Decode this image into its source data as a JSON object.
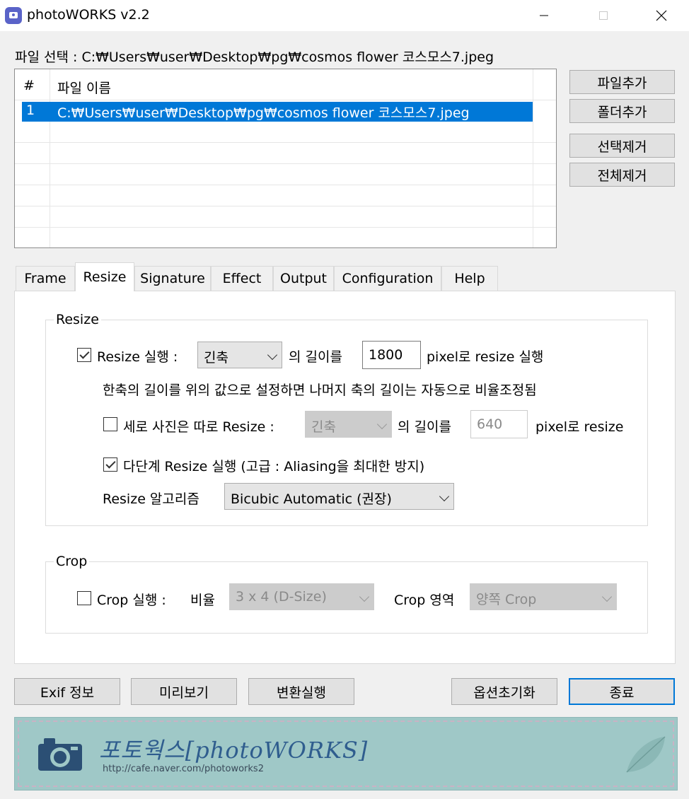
{
  "window": {
    "title": "photoWORKS v2.2",
    "minimize_glyph": "—",
    "maximize_glyph": "☐",
    "close_glyph": "✕"
  },
  "file_select": {
    "label": "파일 선택 : C:₩Users₩user₩Desktop₩pg₩cosmos flower 코스모스7.jpeg"
  },
  "file_list": {
    "columns": [
      "#",
      "파일 이름"
    ],
    "rows": [
      {
        "num": "1",
        "name": "C:₩Users₩user₩Desktop₩pg₩cosmos flower 코스모스7.jpeg",
        "selected": true
      }
    ]
  },
  "side_buttons": {
    "add_file": "파일추가",
    "add_folder": "폴더추가",
    "remove_selected": "선택제거",
    "remove_all": "전체제거"
  },
  "tabs": [
    {
      "label": "Frame",
      "active": false
    },
    {
      "label": "Resize",
      "active": true
    },
    {
      "label": "Signature",
      "active": false
    },
    {
      "label": "Effect",
      "active": false
    },
    {
      "label": "Output",
      "active": false
    },
    {
      "label": "Configuration",
      "active": false
    },
    {
      "label": "Help",
      "active": false
    }
  ],
  "resize_group": {
    "legend": "Resize",
    "run_resize": {
      "label": "Resize 실행 :",
      "checked": true
    },
    "side_select": {
      "value": "긴축"
    },
    "length_label": "의 길이를",
    "length_value": "1800",
    "pixel_label": "pixel로 resize 실행",
    "info_text": "한축의 길이를 위의 값으로 설정하면 나머지 축의 길이는 자동으로 비율조정됨",
    "portrait": {
      "label": "세로 사진은 따로 Resize :",
      "checked": false
    },
    "portrait_select": {
      "value": "긴축"
    },
    "portrait_length_label": "의 길이를",
    "portrait_length_value": "640",
    "portrait_pixel_label": "pixel로 resize",
    "multistep": {
      "label": "다단계 Resize 실행 (고급 : Aliasing을 최대한 방지)",
      "checked": true
    },
    "algorithm_label": "Resize 알고리즘",
    "algorithm_select": {
      "value": "Bicubic Automatic (권장)"
    }
  },
  "crop_group": {
    "legend": "Crop",
    "run_crop": {
      "label": "Crop 실행 :",
      "checked": false
    },
    "ratio_label": "비율",
    "ratio_select": {
      "value": "3 x 4 (D-Size)"
    },
    "area_label": "Crop 영역",
    "area_select": {
      "value": "양쪽 Crop"
    }
  },
  "bottom_buttons": {
    "exif": "Exif 정보",
    "preview": "미리보기",
    "convert": "변환실행",
    "reset_options": "옵션초기화",
    "exit": "종료"
  },
  "banner": {
    "title": "포토웍스[photoWORKS]",
    "url": "http://cafe.naver.com/photoworks2"
  },
  "colors": {
    "selection": "#0078d7",
    "banner_bg": "#9fc8c7",
    "banner_text": "#2f5d8e"
  }
}
